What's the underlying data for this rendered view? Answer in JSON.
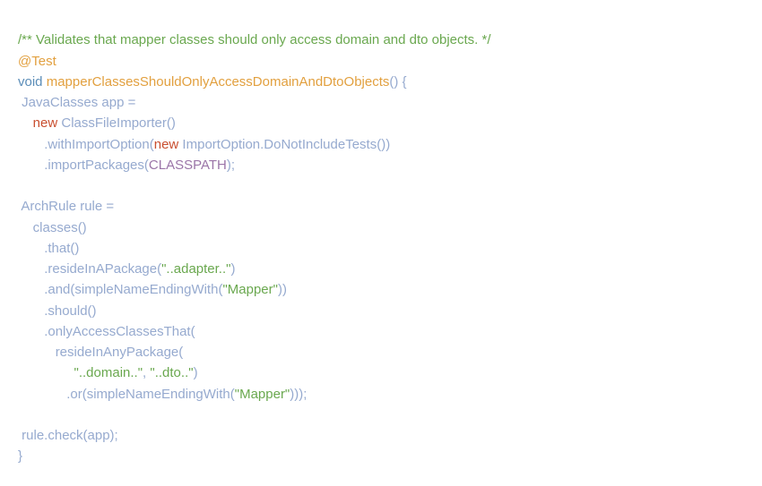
{
  "lines": {
    "l1_comment": "/** Validates that mapper classes should only access domain and dto objects. */",
    "l2_annotation": "@Test",
    "l3_void": "void",
    "l3_method": "mapperClassesShouldOnlyAccessDomainAndDtoObjects",
    "l3_tail": "() {",
    "l4_type": "JavaClasses",
    "l4_var": "app",
    "l4_eq": " =",
    "l5_new": "new",
    "l5_type": "ClassFileImporter",
    "l5_paren": "()",
    "l6_call": ".withImportOption(",
    "l6_new": "new",
    "l6_type": " ImportOption.DoNotIncludeTests())",
    "l7_call": ".importPackages(",
    "l7_const": "CLASSPATH",
    "l7_close": ");",
    "l9_type": "ArchRule",
    "l9_var": " rule =",
    "l10": "classes()",
    "l11": ".that()",
    "l12_a": ".resideInAPackage(",
    "l12_str": "\"..adapter..\"",
    "l12_b": ")",
    "l13_a": ".and(simpleNameEndingWith(",
    "l13_str": "\"Mapper\"",
    "l13_b": "))",
    "l14": ".should()",
    "l15": ".onlyAccessClassesThat(",
    "l16": "resideInAnyPackage(",
    "l17_s1": "\"..domain..\"",
    "l17_comma": ", ",
    "l17_s2": "\"..dto..\"",
    "l17_close": ")",
    "l18_a": ".or(simpleNameEndingWith(",
    "l18_str": "\"Mapper\"",
    "l18_b": ")));",
    "l20_a": "rule.check(app);",
    "l21": "}"
  }
}
